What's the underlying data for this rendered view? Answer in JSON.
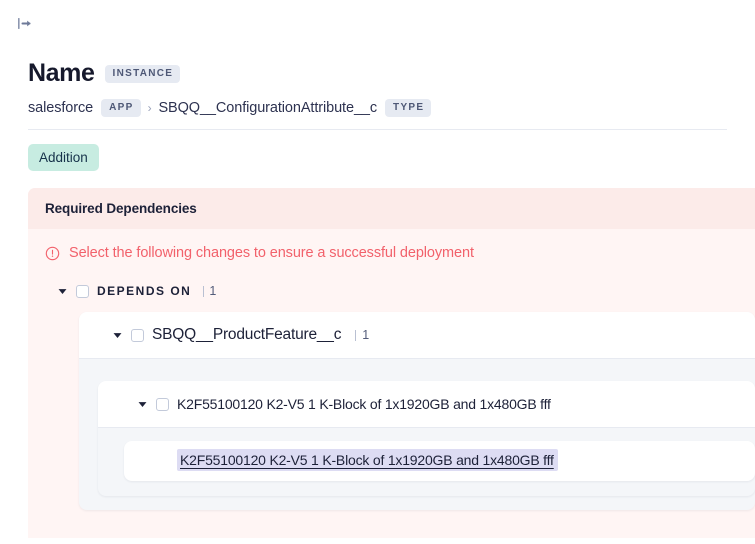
{
  "toolbar": {
    "panel_toggle_icon": "expand-panel-right-icon"
  },
  "header": {
    "title": "Name",
    "title_tag": "INSTANCE",
    "breadcrumb": {
      "app_name": "salesforce",
      "app_tag": "APP",
      "separator": "›",
      "type_name": "SBQQ__ConfigurationAttribute__c",
      "type_tag": "TYPE"
    }
  },
  "status": {
    "label": "Addition",
    "color": "#c7ece1"
  },
  "dependencies": {
    "panel_title": "Required Dependencies",
    "alert_icon": "exclamation-circle-icon",
    "alert_text": "Select the following changes to ensure a successful deployment",
    "alert_color": "#f2616b",
    "tree": {
      "level1": {
        "label": "DEPENDS ON",
        "count": "1",
        "divider": "|",
        "caret": "▼",
        "expanded": true
      },
      "level2": {
        "label": "SBQQ__ProductFeature__c",
        "count": "1",
        "divider": "|",
        "caret": "▼",
        "expanded": true
      },
      "level3": {
        "label": "K2F55100120 K2-V5 1 K-Block of 1x1920GB and 1x480GB fff",
        "caret": "▼",
        "expanded": true
      },
      "leaf": {
        "label": "K2F55100120 K2-V5 1 K-Block of 1x1920GB and 1x480GB fff",
        "highlight_color": "#dddcf3"
      }
    }
  }
}
